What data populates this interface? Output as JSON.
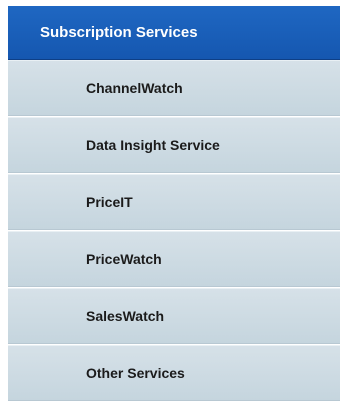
{
  "menu": {
    "header": "Subscription Services",
    "items": [
      {
        "label": "ChannelWatch"
      },
      {
        "label": "Data Insight Service"
      },
      {
        "label": "PriceIT"
      },
      {
        "label": "PriceWatch"
      },
      {
        "label": "SalesWatch"
      },
      {
        "label": "Other Services"
      }
    ]
  },
  "colors": {
    "header_blue": "#1a5fba",
    "item_bg": "#cedbe3",
    "item_text": "#1b1b1b"
  }
}
